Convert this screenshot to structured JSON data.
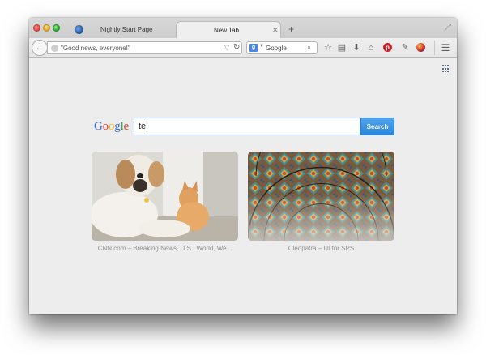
{
  "tabs": [
    {
      "label": "Nightly Start Page",
      "active": false
    },
    {
      "label": "New Tab",
      "active": true
    }
  ],
  "toolbar": {
    "url": "\"Good news, everyone!\"",
    "search_engine": "Google",
    "search_placeholder": ""
  },
  "content": {
    "logo": "Google",
    "search_value": "te",
    "search_button": "Search",
    "tiles": [
      {
        "caption": "CNN.com – Breaking News, U.S., World, We..."
      },
      {
        "caption": "Cleopatra – UI for SPS"
      }
    ]
  },
  "colors": {
    "search_button": "#2b86db",
    "pinterest": "#cb2027",
    "background": "#ededed"
  },
  "icons": [
    "back-arrow-icon",
    "reload-icon",
    "search-icon",
    "bookmark-star-icon",
    "reading-list-icon",
    "downloads-icon",
    "home-icon",
    "pinterest-icon",
    "addon-icon",
    "menu-icon",
    "apps-grid-icon",
    "new-tab-icon",
    "close-tab-icon",
    "fullscreen-icon"
  ]
}
